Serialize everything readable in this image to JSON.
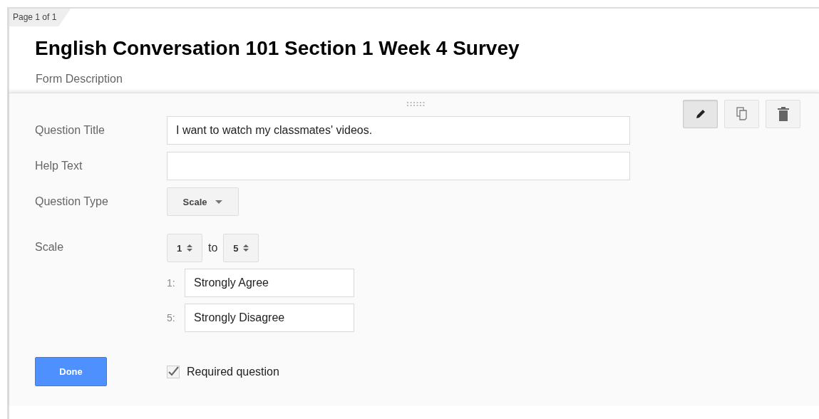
{
  "page_tab": "Page 1 of 1",
  "form": {
    "title": "English Conversation 101 Section 1 Week 4 Survey",
    "description": "Form Description"
  },
  "tools": [
    {
      "kind": "edit",
      "selected": true
    },
    {
      "kind": "duplicate",
      "selected": false
    },
    {
      "kind": "delete",
      "selected": false
    }
  ],
  "question": {
    "title_label": "Question Title",
    "title_value": "I want to watch my classmates' videos.",
    "help_label": "Help Text",
    "type_label": "Question Type",
    "type_value": "Scale",
    "scale_label": "Scale",
    "scale_from": "1",
    "scale_to_word": "to",
    "scale_to": "5",
    "scale_labels": [
      {
        "number": "1:",
        "value": "Strongly Agree"
      },
      {
        "number": "5:",
        "value": "Strongly Disagree"
      }
    ],
    "done_button": "Done",
    "required": {
      "label": "Required question",
      "checked": true
    }
  }
}
